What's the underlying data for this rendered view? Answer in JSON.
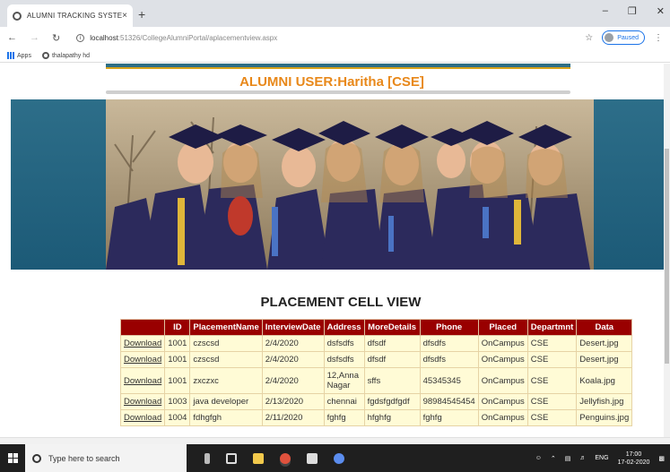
{
  "browser": {
    "tab_title": "ALUMNI TRACKING SYSTEM",
    "tab_close": "×",
    "new_tab": "+",
    "url_host": "localhost",
    "url_rest": ":51326/CollegeAlumniPortal/aplacementview.aspx",
    "profile_status": "Paused",
    "bookmarks": [
      {
        "label": "Apps"
      },
      {
        "label": "thalapathy hd"
      }
    ]
  },
  "page": {
    "user_header": "ALUMNI USER:Haritha [CSE]",
    "section_title": "PLACEMENT CELL VIEW",
    "table": {
      "headers": [
        "",
        "ID",
        "PlacementName",
        "InterviewDate",
        "Address",
        "MoreDetails",
        "Phone",
        "Placed",
        "Departmnt",
        "Data"
      ],
      "rows": [
        {
          "link": "Download",
          "id": "1001",
          "name": "czscsd",
          "date": "2/4/2020",
          "address": "dsfsdfs",
          "details": "dfsdf",
          "phone": "dfsdfs",
          "placed": "OnCampus",
          "dept": "CSE",
          "data": "Desert.jpg"
        },
        {
          "link": "Download",
          "id": "1001",
          "name": "czscsd",
          "date": "2/4/2020",
          "address": "dsfsdfs",
          "details": "dfsdf",
          "phone": "dfsdfs",
          "placed": "OnCampus",
          "dept": "CSE",
          "data": "Desert.jpg"
        },
        {
          "link": "Download",
          "id": "1001",
          "name": "zxczxc",
          "date": "2/4/2020",
          "address": "12,Anna Nagar",
          "details": "sffs",
          "phone": "45345345",
          "placed": "OnCampus",
          "dept": "CSE",
          "data": "Koala.jpg"
        },
        {
          "link": "Download",
          "id": "1003",
          "name": "java developer",
          "date": "2/13/2020",
          "address": "chennai",
          "details": "fgdsfgdfgdf",
          "phone": "98984545454",
          "placed": "OnCampus",
          "dept": "CSE",
          "data": "Jellyfish.jpg"
        },
        {
          "link": "Download",
          "id": "1004",
          "name": "fdhgfgh",
          "date": "2/11/2020",
          "address": "fghfg",
          "details": "hfghfg",
          "phone": "fghfg",
          "placed": "OnCampus",
          "dept": "CSE",
          "data": "Penguins.jpg"
        }
      ]
    }
  },
  "taskbar": {
    "search_placeholder": "Type here to search",
    "lang": "ENG",
    "time": "17:00",
    "date": "17-02-2020"
  },
  "colors": {
    "header_orange": "#e8881a",
    "table_header_bg": "#990000",
    "table_row_bg": "#fffbd6",
    "banner_teal": "#2d6e89"
  }
}
